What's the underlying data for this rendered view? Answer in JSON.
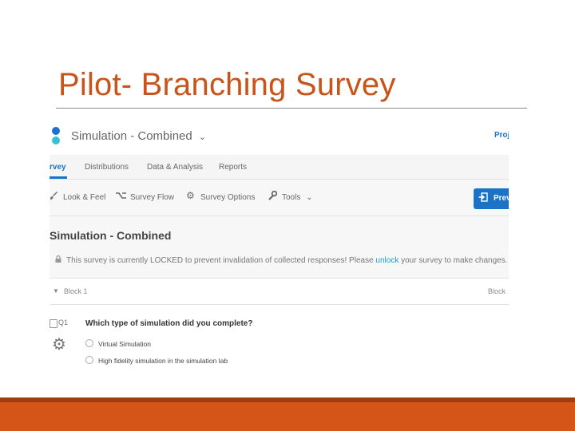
{
  "slide": {
    "title": "Pilot- Branching Survey"
  },
  "app": {
    "project_name": "Simulation - Combined",
    "project_caret": "⌄",
    "projects_link": "Proj"
  },
  "tabs": [
    {
      "label": "rvey",
      "active": true
    },
    {
      "label": "Distributions",
      "active": false
    },
    {
      "label": "Data & Analysis",
      "active": false
    },
    {
      "label": "Reports",
      "active": false
    }
  ],
  "toolbar": {
    "look_and_feel": "Look & Feel",
    "survey_flow": "Survey Flow",
    "survey_options": "Survey Options",
    "tools": "Tools",
    "tools_caret": "⌄",
    "preview": "Prev"
  },
  "survey": {
    "title": "Simulation - Combined",
    "lock_message_before": "This survey is currently LOCKED to prevent invalidation of collected responses! Please",
    "lock_message_link": "unlock",
    "lock_message_after": "your survey to make changes."
  },
  "block": {
    "name": "Block 1",
    "right_label": "Block"
  },
  "question": {
    "id": "Q1",
    "text": "Which type of simulation did you complete?",
    "choices": [
      "Virtual Simulation",
      "High fidelity simulation in the simulation lab"
    ]
  },
  "colors": {
    "title_orange": "#c8541a",
    "footer_orange": "#d55518",
    "footer_dark": "#a23b17",
    "accent_blue": "#1a73c7",
    "logo_blue": "#1f6fd0",
    "logo_teal": "#35c0d4"
  },
  "icons": {
    "look_and_feel": "paint-brush-icon",
    "survey_flow": "flow-icon",
    "survey_options": "gear-icon",
    "tools": "wrench-icon",
    "preview": "preview-icon",
    "lock": "lock-icon",
    "question_settings": "gear-icon"
  }
}
